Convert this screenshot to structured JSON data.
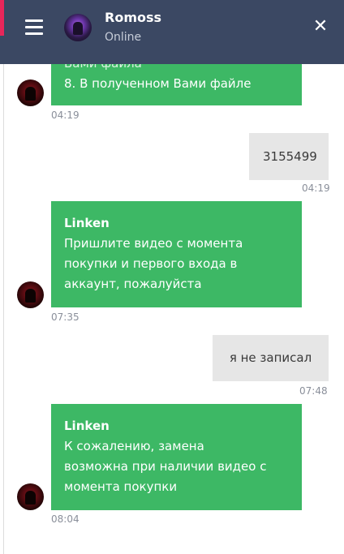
{
  "header": {
    "contact_name": "Romoss",
    "status": "Online",
    "menu_icon": "hamburger-menu-icon",
    "close_icon": "close-icon",
    "accent_color": "#3b4863"
  },
  "messages": [
    {
      "direction": "incoming",
      "line1": "Вами файла",
      "line2": "8. В полученном Вами файле",
      "time": "04:19"
    },
    {
      "direction": "outgoing",
      "text": "3155499",
      "time": "04:19"
    },
    {
      "direction": "incoming",
      "sender": "Linken",
      "line1": "Пришлите видео с момента",
      "line2": "покупки и первого входа в",
      "line3": "аккаунт, пожалуйста",
      "time": "07:35"
    },
    {
      "direction": "outgoing",
      "text": "я не записал",
      "time": "07:48"
    },
    {
      "direction": "incoming",
      "sender": "Linken",
      "line1": "К сожалению, замена",
      "line2": "возможна при наличии видео с",
      "line3": "момента покупки",
      "time": "08:04"
    }
  ],
  "colors": {
    "incoming_bubble": "#3db865",
    "outgoing_bubble": "#e6e6e6",
    "brand_accent": "#e8265a"
  }
}
